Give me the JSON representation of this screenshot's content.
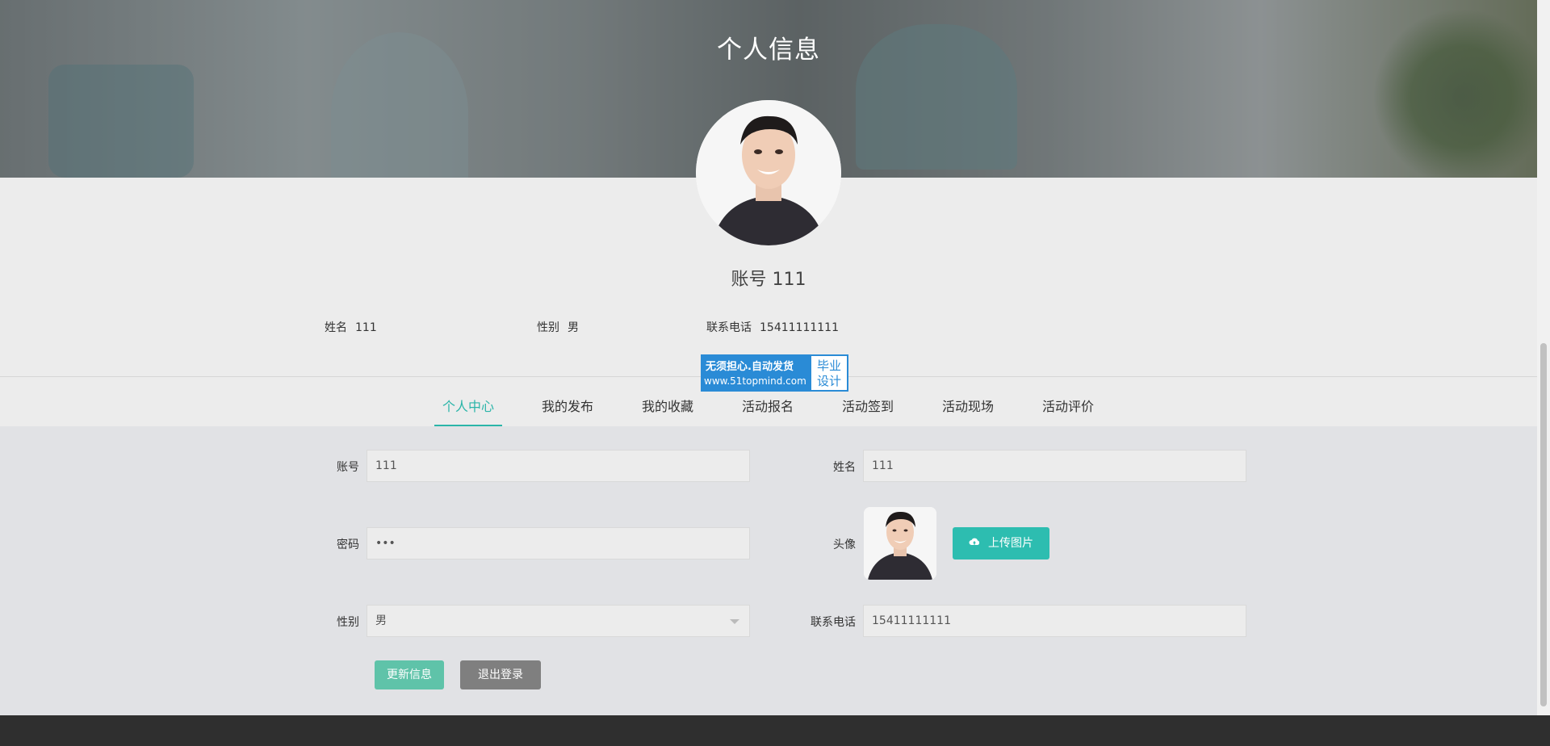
{
  "hero": {
    "title": "个人信息"
  },
  "profile": {
    "account_heading": "账号 111",
    "summary": [
      {
        "label": "姓名",
        "value": "111"
      },
      {
        "label": "性别",
        "value": "男"
      },
      {
        "label": "联系电话",
        "value": "15411111111"
      }
    ]
  },
  "watermark": {
    "line1": "无须担心.自动发货",
    "line2": "www.51topmind.com",
    "badge_line1": "毕业",
    "badge_line2": "设计"
  },
  "tabs": [
    {
      "label": "个人中心",
      "active": true
    },
    {
      "label": "我的发布",
      "active": false
    },
    {
      "label": "我的收藏",
      "active": false
    },
    {
      "label": "活动报名",
      "active": false
    },
    {
      "label": "活动签到",
      "active": false
    },
    {
      "label": "活动现场",
      "active": false
    },
    {
      "label": "活动评价",
      "active": false
    }
  ],
  "form": {
    "account": {
      "label": "账号",
      "value": "111"
    },
    "name": {
      "label": "姓名",
      "value": "111"
    },
    "password": {
      "label": "密码",
      "value": "•••"
    },
    "avatar": {
      "label": "头像",
      "upload_label": "上传图片",
      "upload_icon": "cloud-upload-icon"
    },
    "gender": {
      "label": "性别",
      "value": "男"
    },
    "phone": {
      "label": "联系电话",
      "value": "15411111111"
    },
    "update_button": "更新信息",
    "logout_button": "退出登录"
  },
  "colors": {
    "accent": "#2bb5a9",
    "update_button": "#5fc3a9",
    "logout_button": "#7f7f7f",
    "footer": "#2f2f2f"
  }
}
